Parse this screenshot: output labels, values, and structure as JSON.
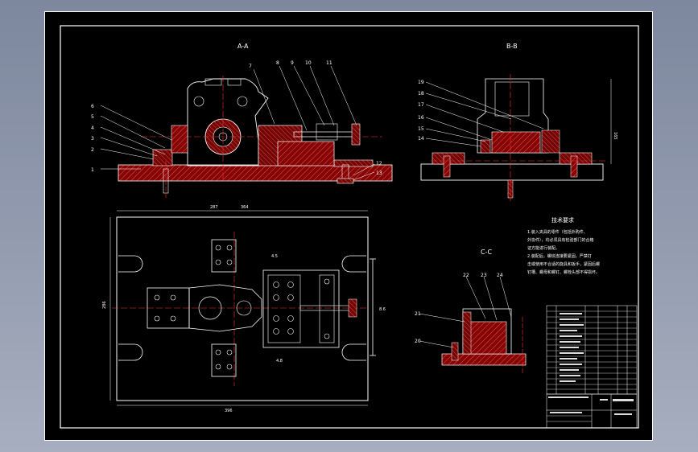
{
  "sections": {
    "aa": "A-A",
    "bb": "B-B",
    "cc": "C-C"
  },
  "notes": {
    "title": "技术要求",
    "lines": [
      "1.装入夹具的零件（包括外购件、",
      "外协件），均必须具有检验部门的合格",
      "证方能进行装配。",
      "2.装配后，螺纹连接要紧固。严禁打",
      "击或使用不合适的旋具和扳手，紧固后螺",
      "钉槽、螺母和螺钉、螺栓头部不得损坏。"
    ]
  },
  "balloons_aa": [
    "1",
    "2",
    "3",
    "4",
    "5",
    "6",
    "7",
    "8",
    "9",
    "10",
    "11",
    "12",
    "13"
  ],
  "balloons_bb": [
    "14",
    "15",
    "16",
    "17",
    "18",
    "19"
  ],
  "balloons_cc": [
    "20",
    "21",
    "22",
    "23",
    "24"
  ],
  "dims": {
    "bb_height": "165",
    "plan_top": "364",
    "plan_top_left": "287",
    "plan_left": "286",
    "plan_bottom": "396",
    "plan_right": "8.6",
    "plan_mid": "4.5",
    "plan_mid2": "4.8"
  },
  "colors": {
    "line": "#ffffff",
    "hatch": "#8b0000",
    "center": "#ff3030",
    "leader": "#ffffff",
    "accent": "#ff00ff"
  }
}
